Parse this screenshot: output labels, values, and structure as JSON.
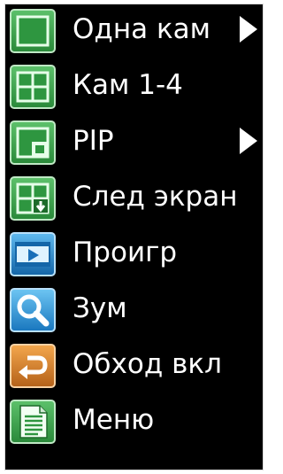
{
  "menu": {
    "items": [
      {
        "label": "Одна кам",
        "icon": "single-screen-icon",
        "has_submenu": true
      },
      {
        "label": "Кам 1-4",
        "icon": "quad-screen-icon",
        "has_submenu": false
      },
      {
        "label": "PIP",
        "icon": "pip-icon",
        "has_submenu": true
      },
      {
        "label": "След экран",
        "icon": "next-screen-icon",
        "has_submenu": false
      },
      {
        "label": "Проигр",
        "icon": "play-icon",
        "has_submenu": false
      },
      {
        "label": "Зум",
        "icon": "zoom-icon",
        "has_submenu": false
      },
      {
        "label": "Обход вкл",
        "icon": "return-arrow-icon",
        "has_submenu": false
      },
      {
        "label": "Меню",
        "icon": "document-icon",
        "has_submenu": false
      }
    ]
  },
  "colors": {
    "background": "#000000",
    "text": "#ffffff",
    "green_icon": "#3a9a4a",
    "blue_icon": "#1f86c8",
    "orange_icon": "#d9822b"
  }
}
